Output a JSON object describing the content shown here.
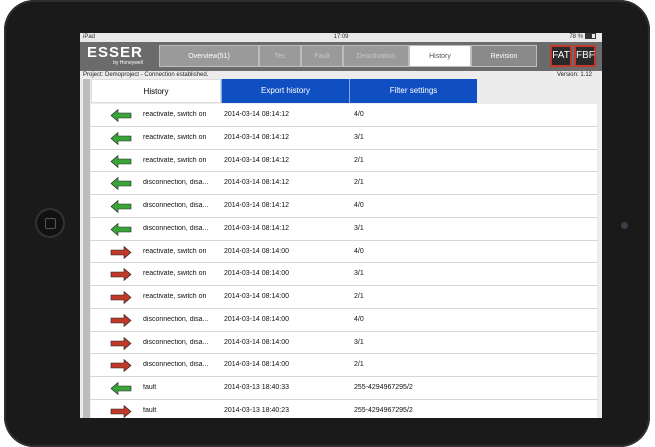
{
  "status_bar": {
    "device": "iPad",
    "time": "17:09",
    "battery": "78 %"
  },
  "header": {
    "logo_text": "ESSER",
    "logo_subtext": "by Honeywell",
    "tabs": [
      {
        "label": "Overview(51)",
        "state": "enabled"
      },
      {
        "label": "Tec",
        "state": "dim"
      },
      {
        "label": "Fault",
        "state": "dim"
      },
      {
        "label": "Deactivation",
        "state": "dim"
      },
      {
        "label": "History",
        "state": "active"
      },
      {
        "label": "Revision",
        "state": "enabled"
      }
    ],
    "fat_label": "FAT",
    "fbf_label": "FBF"
  },
  "project_line": {
    "text": "Project: Demoproject - Connection established.",
    "version": "Version: 1.12"
  },
  "subtabs": {
    "history": "History",
    "export": "Export history",
    "filter": "Filter settings"
  },
  "colors": {
    "arrow_green": "#3aa43a",
    "arrow_red": "#c0392b",
    "tab_blue": "#0f4fc2"
  },
  "rows": [
    {
      "icon": "green-left-arrow-icon",
      "description": "reactivate, switch on",
      "timestamp": "2014-03-14 08:14:12",
      "value": "4/0"
    },
    {
      "icon": "green-left-arrow-icon",
      "description": "reactivate, switch on",
      "timestamp": "2014-03-14 08:14:12",
      "value": "3/1"
    },
    {
      "icon": "green-left-arrow-icon",
      "description": "reactivate, switch on",
      "timestamp": "2014-03-14 08:14:12",
      "value": "2/1"
    },
    {
      "icon": "green-left-arrow-icon",
      "description": "disconnection, disa...",
      "timestamp": "2014-03-14 08:14:12",
      "value": "2/1"
    },
    {
      "icon": "green-left-arrow-icon",
      "description": "disconnection, disa...",
      "timestamp": "2014-03-14 08:14:12",
      "value": "4/0"
    },
    {
      "icon": "green-left-arrow-icon",
      "description": "disconnection, disa...",
      "timestamp": "2014-03-14 08:14:12",
      "value": "3/1"
    },
    {
      "icon": "red-right-arrow-icon",
      "description": "reactivate, switch on",
      "timestamp": "2014-03-14 08:14:00",
      "value": "4/0"
    },
    {
      "icon": "red-right-arrow-icon",
      "description": "reactivate, switch on",
      "timestamp": "2014-03-14 08:14:00",
      "value": "3/1"
    },
    {
      "icon": "red-right-arrow-icon",
      "description": "reactivate, switch on",
      "timestamp": "2014-03-14 08:14:00",
      "value": "2/1"
    },
    {
      "icon": "red-right-arrow-icon",
      "description": "disconnection, disa...",
      "timestamp": "2014-03-14 08:14:00",
      "value": "4/0"
    },
    {
      "icon": "red-right-arrow-icon",
      "description": "disconnection, disa...",
      "timestamp": "2014-03-14 08:14:00",
      "value": "3/1"
    },
    {
      "icon": "red-right-arrow-icon",
      "description": "disconnection, disa...",
      "timestamp": "2014-03-14 08:14:00",
      "value": "2/1"
    },
    {
      "icon": "green-left-arrow-icon",
      "description": "fault",
      "timestamp": "2014-03-13 18:40:33",
      "value": "255-4294967295/2"
    },
    {
      "icon": "red-right-arrow-icon",
      "description": "fault",
      "timestamp": "2014-03-13 18:40:23",
      "value": "255-4294967295/2"
    }
  ]
}
